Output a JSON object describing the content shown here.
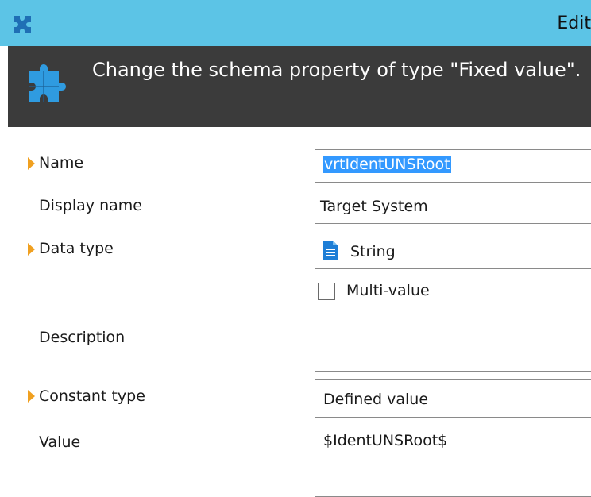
{
  "window": {
    "title": "Edit"
  },
  "header": {
    "text": "Change the schema property of type \"Fixed value\"."
  },
  "icons": {
    "app": "puzzle-icon",
    "header": "puzzle-icon",
    "data_type": "document-icon"
  },
  "colors": {
    "titlebar": "#5cc4e6",
    "header": "#3b3b3b",
    "required_marker": "#f0a020",
    "selection": "#3399ff"
  },
  "form": {
    "name": {
      "label": "Name",
      "value": "vrtIdentUNSRoot",
      "required": true
    },
    "display_name": {
      "label": "Display name",
      "value": "Target System"
    },
    "data_type": {
      "label": "Data type",
      "value": "String",
      "required": true
    },
    "multi_value": {
      "label": "Multi-value",
      "checked": false
    },
    "description": {
      "label": "Description",
      "value": ""
    },
    "constant_type": {
      "label": "Constant type",
      "value": "Defined value",
      "required": true
    },
    "value": {
      "label": "Value",
      "value": "$IdentUNSRoot$"
    }
  }
}
